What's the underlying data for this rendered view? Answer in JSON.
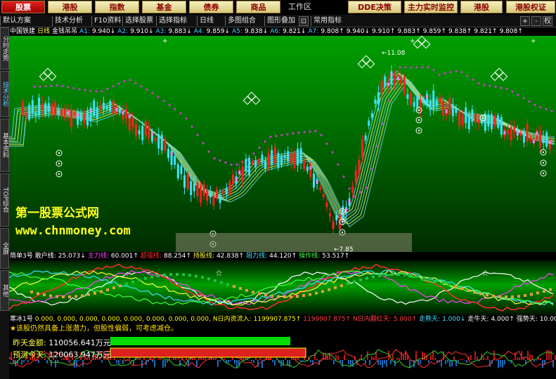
{
  "nav": {
    "buttons": [
      "股票",
      "港股",
      "指数",
      "基金",
      "债券",
      "商品",
      "工作区",
      "DDE决策",
      "主力实时监控",
      "港股",
      "港股权证"
    ],
    "active_index": 0
  },
  "toolbar": {
    "items": [
      "默认方案",
      "技术分析",
      "F10资料",
      "选择股票",
      "选择指标",
      "日线",
      "多图组合",
      "图形叠加",
      "常用指标"
    ],
    "right_icons": [
      "zoom-in-icon",
      "zoom-out-icon",
      "close-icon"
    ],
    "right_labels": [
      "+",
      "-",
      "权"
    ]
  },
  "sidebar": {
    "tabs": [
      "分时走势",
      "技术分析",
      "基本资料",
      "TOP综合",
      "全屏",
      "其他"
    ],
    "active_index": 1
  },
  "main_chart": {
    "stock": "中国铁建",
    "period": "日线",
    "indicator": "金钱吊吊",
    "ma_values": [
      {
        "label": "A1:",
        "value": "9.940↓"
      },
      {
        "label": "A2:",
        "value": "9.910↓"
      },
      {
        "label": "A3:",
        "value": "9.883↓"
      },
      {
        "label": "A4:",
        "value": "9.859↓"
      },
      {
        "label": "A5:",
        "value": "9.838↓"
      },
      {
        "label": "A6:",
        "value": "9.821↓"
      },
      {
        "label": "A7:",
        "value": "9.808↑"
      },
      {
        "label": "",
        "value": "9.940↓"
      },
      {
        "label": "",
        "value": "9.910↑"
      },
      {
        "label": "",
        "value": "9.883↑"
      },
      {
        "label": "",
        "value": "9.859↑"
      },
      {
        "label": "",
        "value": "9.838↑"
      },
      {
        "label": "",
        "value": "9.821↑"
      },
      {
        "label": "",
        "value": "9.808↑"
      }
    ],
    "high_label": "11.08",
    "low_label": "7.85",
    "arrow_high": "←",
    "arrow_low": "←"
  },
  "watermark": {
    "title": "第一股票公式网",
    "url": "www.chnmoney.com"
  },
  "indicator1": {
    "name": "简单3号",
    "values": [
      {
        "label": "散户线:",
        "value": "25.073↓",
        "color": "#ffffff"
      },
      {
        "label": "主力线:",
        "value": "60.001↑",
        "color": "#ff40ff"
      },
      {
        "label": "超强线:",
        "value": "88.254↑",
        "color": "#ff3030"
      },
      {
        "label": "持股线:",
        "value": "42.838↑",
        "color": "#ffff40"
      },
      {
        "label": "阻力线:",
        "value": "44.120↑",
        "color": "#40e0ff"
      },
      {
        "label": "操作线:",
        "value": "53.517↑",
        "color": "#40ff40"
      }
    ]
  },
  "indicator2": {
    "name": "寒冰1号",
    "values": [
      {
        "label": "",
        "value": "0.000,",
        "color": "#ffff00"
      },
      {
        "label": "",
        "value": "0.000,",
        "color": "#ffff00"
      },
      {
        "label": "",
        "value": "0.000,",
        "color": "#ffff00"
      },
      {
        "label": "",
        "value": "0.000,",
        "color": "#ffff00"
      },
      {
        "label": "",
        "value": "0.000,",
        "color": "#ffff00"
      },
      {
        "label": "",
        "value": "0.000,",
        "color": "#ffff00"
      },
      {
        "label": "",
        "value": "0.000,",
        "color": "#ffff00"
      },
      {
        "label": "",
        "value": "0.000,",
        "color": "#ffff00"
      },
      {
        "label": "N日内资流入:",
        "value": "1199907.875↑",
        "color": "#ffff00"
      },
      {
        "label": "",
        "value": "1199907.875↑",
        "color": "#ff4040"
      },
      {
        "label": "N日内翻红天:",
        "value": "5.000↑",
        "color": "#ff4040"
      },
      {
        "label": "走熊天:",
        "value": "1.000↓",
        "color": "#40e0ff"
      },
      {
        "label": "走牛天:",
        "value": "4.000↑",
        "color": "#ffffff"
      },
      {
        "label": "强势天:",
        "value": "10.000↑",
        "color": "#ffffff"
      }
    ],
    "message": "★该股仍然具备上涨潜力，但股性偏弱，可考虑减仓。",
    "yesterday_label": "昨天金额:",
    "yesterday_value": "110056.641万元",
    "today_label": "预测今天:",
    "today_value": "120063.947万元",
    "yesterday_bar_fraction": 1.0,
    "today_bar_fraction": 1.0
  },
  "colors": {
    "up": "#ff2020",
    "down": "#40e0ff",
    "bg_top": "#006000",
    "bg_bottom": "#001800",
    "dots": "#c040c0",
    "yellow_band": "#f0f060",
    "cyan_band": "#70e0e0"
  }
}
